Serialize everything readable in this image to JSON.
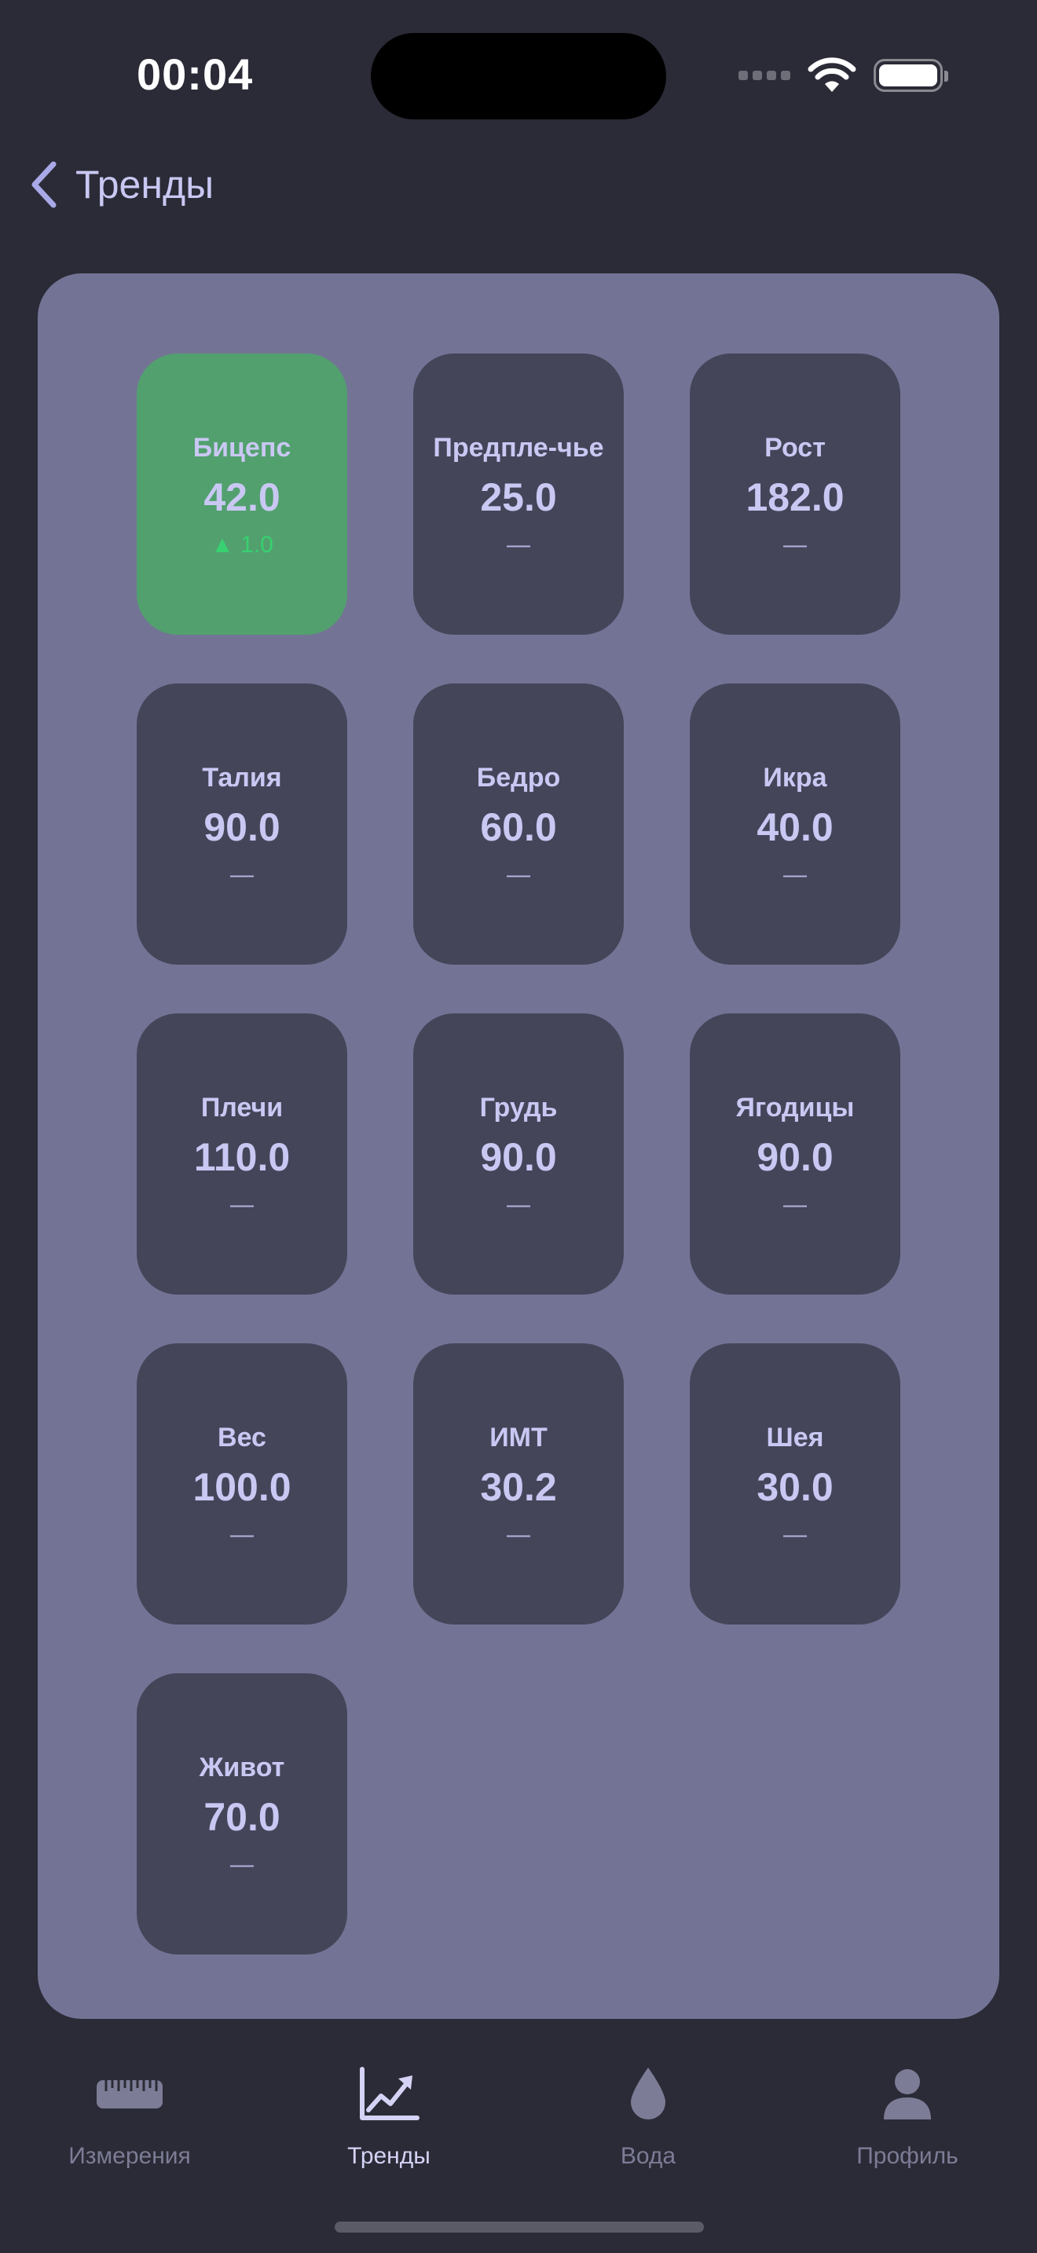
{
  "status_bar": {
    "time": "00:04"
  },
  "nav": {
    "back_label": "Тренды"
  },
  "colors": {
    "background": "#2b2b37",
    "panel": "#737495",
    "tile": "#45455a",
    "tile_highlight": "#52a06e",
    "accent_text": "#c9c8f3",
    "delta_up": "#38d070",
    "tab_inactive": "#7c7c96"
  },
  "tiles": [
    {
      "name": "Бицепс",
      "value": "42.0",
      "delta": "▲ 1.0",
      "highlight": true
    },
    {
      "name": "Предпле-чье",
      "value": "25.0",
      "delta": "—",
      "highlight": false
    },
    {
      "name": "Рост",
      "value": "182.0",
      "delta": "—",
      "highlight": false
    },
    {
      "name": "Талия",
      "value": "90.0",
      "delta": "—",
      "highlight": false
    },
    {
      "name": "Бедро",
      "value": "60.0",
      "delta": "—",
      "highlight": false
    },
    {
      "name": "Икра",
      "value": "40.0",
      "delta": "—",
      "highlight": false
    },
    {
      "name": "Плечи",
      "value": "110.0",
      "delta": "—",
      "highlight": false
    },
    {
      "name": "Грудь",
      "value": "90.0",
      "delta": "—",
      "highlight": false
    },
    {
      "name": "Ягодицы",
      "value": "90.0",
      "delta": "—",
      "highlight": false
    },
    {
      "name": "Вес",
      "value": "100.0",
      "delta": "—",
      "highlight": false
    },
    {
      "name": "ИМТ",
      "value": "30.2",
      "delta": "—",
      "highlight": false
    },
    {
      "name": "Шея",
      "value": "30.0",
      "delta": "—",
      "highlight": false
    },
    {
      "name": "Живот",
      "value": "70.0",
      "delta": "—",
      "highlight": false
    }
  ],
  "tab_bar": {
    "items": [
      {
        "label": "Измерения",
        "icon": "ruler-icon",
        "active": false
      },
      {
        "label": "Тренды",
        "icon": "trend-chart-icon",
        "active": true
      },
      {
        "label": "Вода",
        "icon": "water-drop-icon",
        "active": false
      },
      {
        "label": "Профиль",
        "icon": "person-icon",
        "active": false
      }
    ]
  }
}
